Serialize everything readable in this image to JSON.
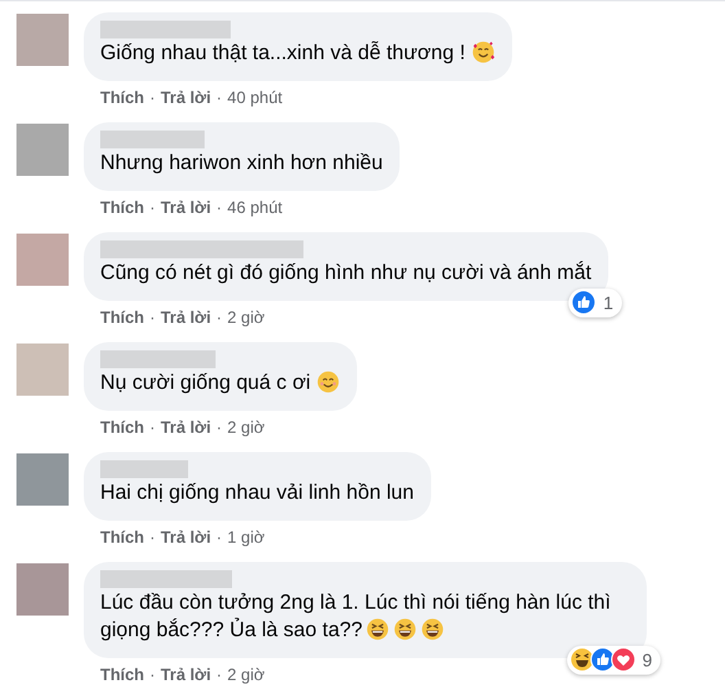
{
  "comments": [
    {
      "text": "Giống nhau thật ta...xinh và dễ thương !",
      "emojis": [
        {
          "kind": "love-face"
        }
      ],
      "actions": [
        {
          "kind": "link",
          "label": "Thích"
        },
        {
          "kind": "separator",
          "label": "·"
        },
        {
          "kind": "link",
          "label": "Trả lời"
        },
        {
          "kind": "separator",
          "label": "·"
        }
      ],
      "time": "40 phút"
    },
    {
      "text": "Nhưng hariwon xinh hơn nhiều",
      "actions": [
        {
          "kind": "link",
          "label": "Thích"
        },
        {
          "kind": "separator",
          "label": "·"
        },
        {
          "kind": "link",
          "label": "Trả lời"
        },
        {
          "kind": "separator",
          "label": "·"
        }
      ],
      "time": "46 phút"
    },
    {
      "text": "Cũng có nét gì đó giống hình như nụ cười và ánh mắt",
      "actions": [
        {
          "kind": "link",
          "label": "Thích"
        },
        {
          "kind": "separator",
          "label": "·"
        },
        {
          "kind": "link",
          "label": "Trả lời"
        },
        {
          "kind": "separator",
          "label": "·"
        }
      ],
      "time": "2 giờ",
      "reactions": {
        "icons": [
          {
            "kind": "like"
          }
        ],
        "count": "1"
      }
    },
    {
      "text": "Nụ cười giống quá c ơi",
      "emojis": [
        {
          "kind": "smile"
        }
      ],
      "actions": [
        {
          "kind": "link",
          "label": "Thích"
        },
        {
          "kind": "separator",
          "label": "·"
        },
        {
          "kind": "link",
          "label": "Trả lời"
        },
        {
          "kind": "separator",
          "label": "·"
        }
      ],
      "time": "2 giờ"
    },
    {
      "text": "Hai chị giống nhau vải linh hồn lun",
      "actions": [
        {
          "kind": "link",
          "label": "Thích"
        },
        {
          "kind": "separator",
          "label": "·"
        },
        {
          "kind": "link",
          "label": "Trả lời"
        },
        {
          "kind": "separator",
          "label": "·"
        }
      ],
      "time": "1 giờ"
    },
    {
      "text": "Lúc đầu còn tưởng 2ng là 1. Lúc thì nói tiếng hàn lúc thì giọng bắc??? Ủa là sao ta??",
      "emojis": [
        {
          "kind": "laugh"
        },
        {
          "kind": "laugh"
        },
        {
          "kind": "laugh"
        }
      ],
      "actions": [
        {
          "kind": "link",
          "label": "Thích"
        },
        {
          "kind": "separator",
          "label": "·"
        },
        {
          "kind": "link",
          "label": "Trả lời"
        },
        {
          "kind": "separator",
          "label": "·"
        }
      ],
      "time": "2 giờ",
      "reactions": {
        "icons": [
          {
            "kind": "haha"
          },
          {
            "kind": "like"
          },
          {
            "kind": "love"
          }
        ],
        "count": "9"
      }
    }
  ]
}
